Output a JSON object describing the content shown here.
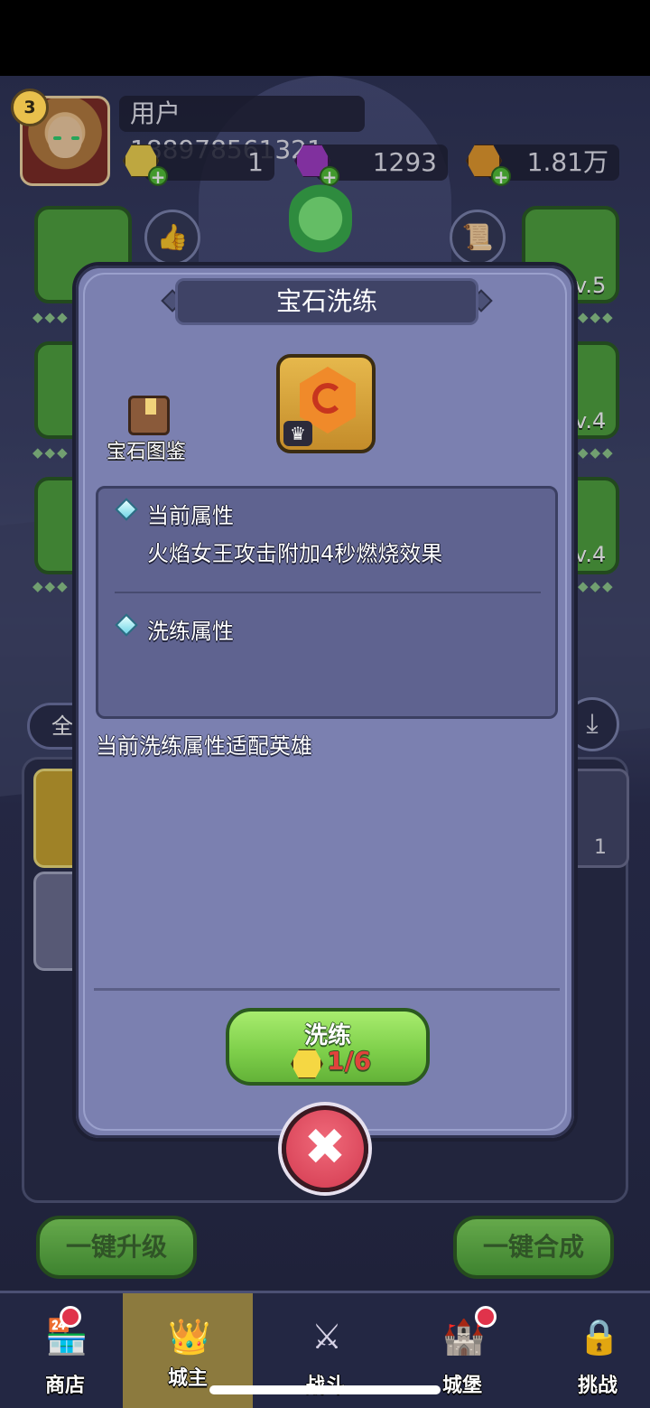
{
  "hud": {
    "level": "3",
    "username": "用户188978561321",
    "resources": [
      {
        "icon": "gold-gem-icon",
        "value": "1"
      },
      {
        "icon": "purple-crystal-icon",
        "value": "1293"
      },
      {
        "icon": "coin-icon",
        "value": "1.81万"
      }
    ]
  },
  "side_levels": [
    "v.5",
    "v.4",
    "v.4"
  ],
  "background_panel": {
    "filter_label": "全",
    "slot_count": "1",
    "upgrade_all_label": "一键升级",
    "merge_all_label": "一键合成"
  },
  "modal": {
    "title": "宝石洗练",
    "codex_label": "宝石图鉴",
    "current_attr_title": "当前属性",
    "current_attr_value": "火焰女王攻击附加4秒燃烧效果",
    "refine_attr_title": "洗练属性",
    "refine_attr_value": "",
    "hint": "当前洗练属性适配英雄",
    "refine_button_label": "洗练",
    "refine_cost": "1/6",
    "close_icon": "✖"
  },
  "nav": [
    {
      "label": "商店",
      "icon": "shop-icon",
      "badge": true
    },
    {
      "label": "城主",
      "icon": "crown-icon",
      "badge": false,
      "active": true
    },
    {
      "label": "战斗",
      "icon": "swords-icon",
      "badge": false
    },
    {
      "label": "城堡",
      "icon": "castle-icon",
      "badge": true
    },
    {
      "label": "挑战",
      "icon": "lock-icon",
      "badge": false
    }
  ],
  "colors": {
    "accent_green": "#7fd04b",
    "modal_bg": "#7b80b0",
    "badge_red": "#e0334b",
    "cost_red": "#e0433c"
  }
}
